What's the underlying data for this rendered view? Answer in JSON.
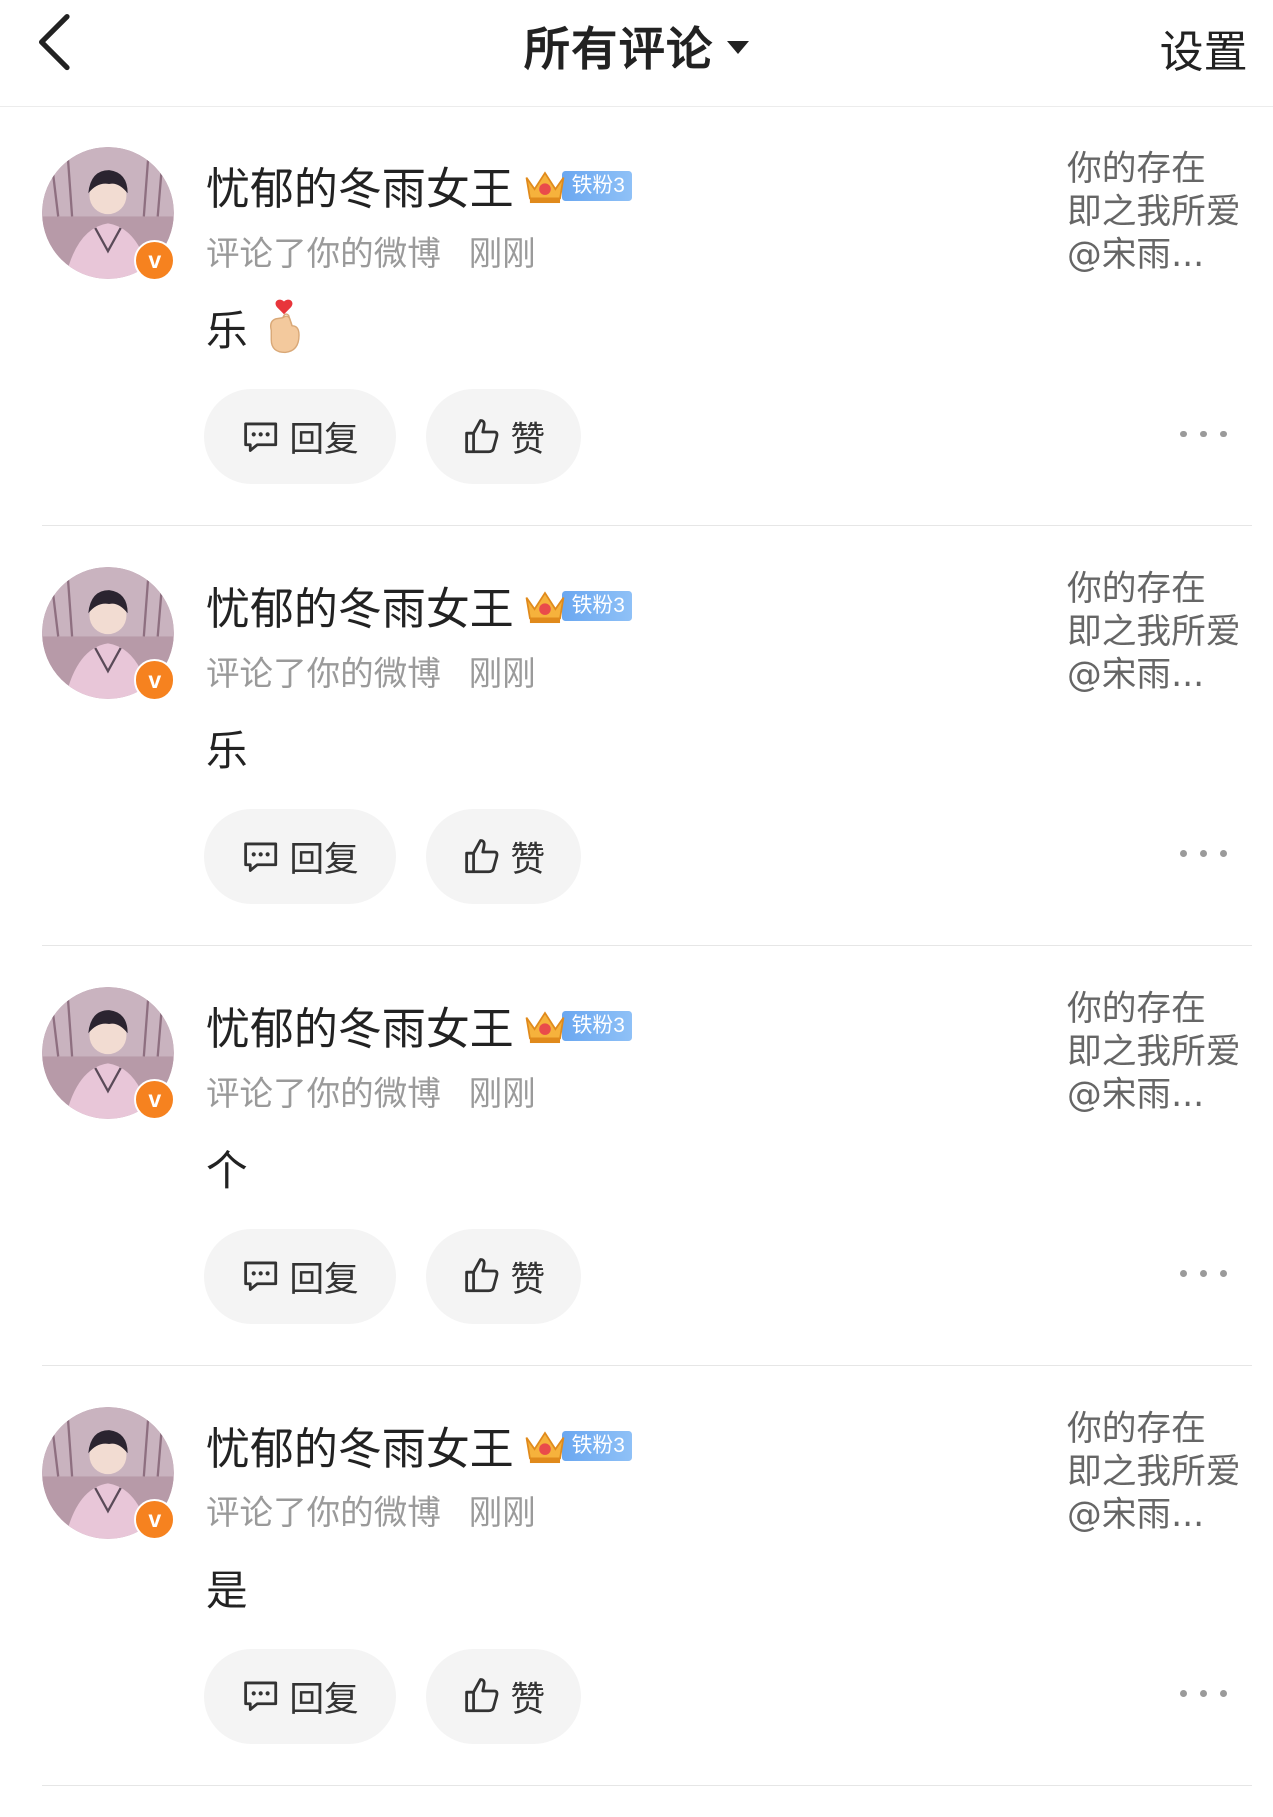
{
  "header": {
    "title": "所有评论",
    "settings_label": "设置"
  },
  "colors": {
    "verified_badge": "#f6821f",
    "fan_badge": "#7fb4f4",
    "meta_text": "#9a9a9a",
    "pill_bg": "#f4f4f4"
  },
  "comments": [
    {
      "username": "忧郁的冬雨女王",
      "fan_badge": "铁粉3",
      "action": "评论了你的微博",
      "time": "刚刚",
      "content": "乐",
      "emoji": "finger-heart-emoji",
      "reply_label": "回复",
      "like_label": "赞",
      "origin": [
        "你的存在",
        "即之我所爱",
        "@宋雨..."
      ]
    },
    {
      "username": "忧郁的冬雨女王",
      "fan_badge": "铁粉3",
      "action": "评论了你的微博",
      "time": "刚刚",
      "content": "乐",
      "reply_label": "回复",
      "like_label": "赞",
      "origin": [
        "你的存在",
        "即之我所爱",
        "@宋雨..."
      ]
    },
    {
      "username": "忧郁的冬雨女王",
      "fan_badge": "铁粉3",
      "action": "评论了你的微博",
      "time": "刚刚",
      "content": "个",
      "reply_label": "回复",
      "like_label": "赞",
      "origin": [
        "你的存在",
        "即之我所爱",
        "@宋雨..."
      ]
    },
    {
      "username": "忧郁的冬雨女王",
      "fan_badge": "铁粉3",
      "action": "评论了你的微博",
      "time": "刚刚",
      "content": "是",
      "reply_label": "回复",
      "like_label": "赞",
      "origin": [
        "你的存在",
        "即之我所爱",
        "@宋雨..."
      ]
    }
  ]
}
